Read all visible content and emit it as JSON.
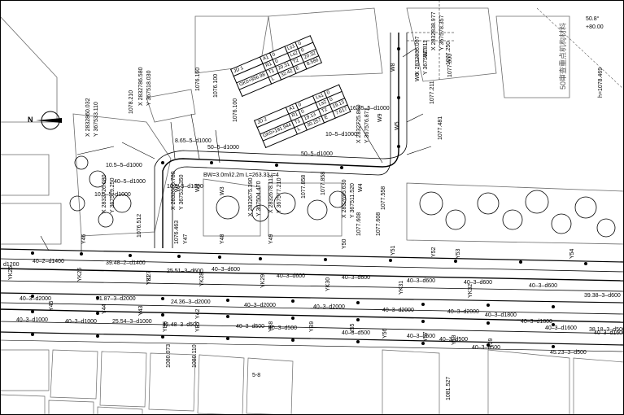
{
  "colors": {
    "background": "#ffffff",
    "ink": "#000000",
    "block_outline": "#6b6b6b",
    "road_edge": "#000000"
  },
  "north_arrow": {
    "icon": "north-arrow-icon",
    "label": "N"
  },
  "curve_table_1": {
    "rows": [
      [
        "JD 1",
        "A1",
        "0",
        "Ls1",
        "0"
      ],
      [
        "",
        "R1",
        "0",
        "Ls2",
        "0"
      ],
      [
        "GK0+956.98",
        "T1",
        "20.31",
        "T2",
        "20.32"
      ],
      [
        "",
        "L",
        "32.42",
        "E",
        "8.586"
      ]
    ]
  },
  "curve_table_2": {
    "rows": [
      [
        "JD 2",
        "A1",
        "0",
        "Ls1",
        "0"
      ],
      [
        "",
        "R1",
        "0",
        "Ls2",
        "0"
      ],
      [
        "GK0+191.944",
        "T1",
        "19.13",
        "T2",
        "19.13"
      ],
      [
        "",
        "L",
        "30.257",
        "E",
        "7.617"
      ]
    ]
  },
  "annotations": {
    "road_profile": "BW=3.0m/i2.2m  L=263.33  i=4",
    "upper_right_label": "50.8°",
    "upper_right_label_2": "+80.00",
    "upper_right_elev": "h=1078.469",
    "upper_right_caption": "50审查重点机构材料",
    "bottom_text": "5-8"
  },
  "pipe_labels": [
    "40–2–d1400",
    "39.48–2–d1400",
    "40–3–d600",
    "25.51–3–d600",
    "40–3–d600",
    "40–3–d600",
    "40–3–d600",
    "40–3–d600",
    "40–3–d600",
    "39.38–3–d600",
    "40–3–d2000",
    "51.87–3–d2000",
    "24.36–3–d2000",
    "40–3–d2000",
    "40–3–d2000",
    "40–3–d2000",
    "40–3–d2000",
    "40–3–d1800",
    "40–3–d1800",
    "40–3–d1600",
    "40–3–d1600",
    "40–3–d1000",
    "40–3–d1000",
    "25.54–3–d1000",
    "41.48–3–d500",
    "40–3–d500",
    "40–3–d500",
    "40–3–d500",
    "40–3–d500",
    "40–3–d500",
    "40–3–d500",
    "45.23–3–d500",
    "38.18–3–d500",
    "50–5–d1000",
    "50–5–d1000",
    "10.5–5–d1000",
    "10–5–d1000",
    "16.35–5–d1000",
    "10.5–5–d1000",
    "10.5–5–d1000",
    "8.65–5–d1000",
    "40–5–d1000",
    "d1200"
  ],
  "elevations": [
    "1077.858",
    "1077.858",
    "1077.608",
    "1077.608",
    "1077.558",
    "1077.481",
    "1077.211",
    "1077.000",
    "1076.100",
    "1076.100",
    "1076.160",
    "1078.210",
    "1080.073",
    "1080.110",
    "1081.527",
    "1076.512",
    "1076.463",
    "1077.250"
  ],
  "node_labels": [
    "Y53",
    "Y54",
    "Y52",
    "Y51",
    "Y50",
    "Y49",
    "Y48",
    "Y47",
    "Y46",
    "YB6",
    "YB7",
    "YB8",
    "YB9",
    "Y55",
    "Y56",
    "Y57",
    "Y58",
    "Y59",
    "YK25",
    "YK26",
    "YK27",
    "YK28",
    "YK29",
    "YK30",
    "YK31",
    "YK32",
    "W1",
    "W2",
    "W3",
    "W4",
    "W5",
    "W6",
    "W7",
    "W8",
    "W9",
    "Y31",
    "Y45",
    "Y44",
    "Y43",
    "Y42"
  ],
  "coordinates": [
    "X 2832860.032",
    "Y 367533.110",
    "X 2832786.580",
    "Y 367518.030",
    "X 2832726.680",
    "Y 367519.250",
    "X 2832686.780",
    "Y 367532.350",
    "X 2832678.113",
    "Y 367577.210",
    "X 2832675.390",
    "Y 367504.470",
    "X 2832695.630",
    "Y 367511.520",
    "X 2832725.860",
    "Y 367576.871",
    "X 2832836.007",
    "Y 367562.811",
    "X 2832838.977",
    "Y 367578.357"
  ]
}
